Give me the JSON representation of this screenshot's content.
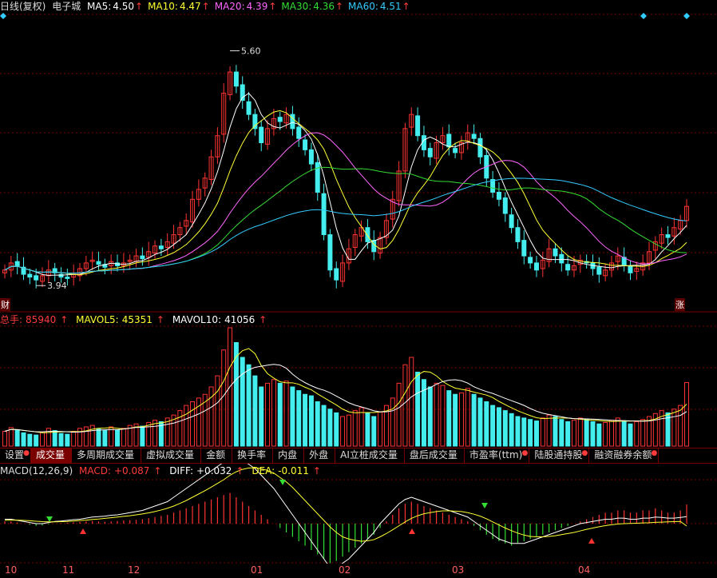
{
  "price_header": {
    "title": "日线(复权)",
    "stock": "电子城",
    "ma": [
      {
        "label": "MA5:",
        "value": "4.50",
        "color": "#ffffff"
      },
      {
        "label": "MA10:",
        "value": "4.47",
        "color": "#ffff33"
      },
      {
        "label": "MA20:",
        "value": "4.39",
        "color": "#ff66ff"
      },
      {
        "label": "MA30:",
        "value": "4.36",
        "color": "#33dd33"
      },
      {
        "label": "MA60:",
        "value": "4.51",
        "color": "#33ccff"
      }
    ],
    "arrow": "↑"
  },
  "price_annotations": {
    "high": "5.60",
    "low": "3.94"
  },
  "corner": {
    "left": "财",
    "right": "涨"
  },
  "volume_header": {
    "total_label": "总手:",
    "total_value": "85940",
    "mavol5_label": "MAVOL5:",
    "mavol5_value": "45351",
    "mavol10_label": "MAVOL10:",
    "mavol10_value": "41056",
    "arrow": "↑"
  },
  "tabs": [
    {
      "label": "设置",
      "dot": true
    },
    {
      "label": "成交量",
      "active": true
    },
    {
      "label": "多周期成交量"
    },
    {
      "label": "虚拟成交量"
    },
    {
      "label": "金额"
    },
    {
      "label": "换手率"
    },
    {
      "label": "内盘"
    },
    {
      "label": "外盘"
    },
    {
      "label": "AI立桩成交量"
    },
    {
      "label": "盘后成交量"
    },
    {
      "label": "市盈率(ttm)",
      "dot": true
    },
    {
      "label": "陆股通持股",
      "dot": true
    },
    {
      "label": "融资融券余额",
      "dot": true
    }
  ],
  "macd_header": {
    "title": "MACD(12,26,9)",
    "macd_label": "MACD:",
    "macd_value": "+0.087",
    "diff_label": "DIFF:",
    "diff_value": "+0.032",
    "dea_label": "DEA:",
    "dea_value": "-0.011",
    "arrow": "↑"
  },
  "x_axis": {
    "labels": [
      "10",
      "11",
      "12",
      "01",
      "02",
      "03",
      "04"
    ]
  },
  "colors": {
    "up": "#ff3333",
    "down": "#44eeee",
    "ma5": "#ffffff",
    "ma10": "#ffff33",
    "ma20": "#ff66ff",
    "ma30": "#33dd33",
    "ma60": "#33ccff",
    "grid": "#7a0000"
  },
  "chart_data": {
    "type": "candlestick",
    "price_range": [
      3.8,
      5.75
    ],
    "high": 5.6,
    "low": 3.94,
    "closes": [
      4.05,
      4.1,
      4.08,
      4.02,
      4.0,
      3.98,
      4.01,
      4.05,
      4.03,
      4.0,
      3.99,
      4.02,
      4.06,
      4.1,
      4.12,
      4.09,
      4.07,
      4.11,
      4.08,
      4.1,
      4.12,
      4.15,
      4.13,
      4.18,
      4.22,
      4.2,
      4.25,
      4.3,
      4.35,
      4.4,
      4.55,
      4.62,
      4.7,
      4.85,
      5.0,
      5.3,
      5.45,
      5.35,
      5.25,
      5.15,
      5.05,
      4.95,
      5.05,
      5.12,
      5.1,
      5.15,
      5.05,
      4.98,
      4.9,
      4.8,
      4.6,
      4.3,
      4.05,
      3.98,
      4.1,
      4.2,
      4.3,
      4.35,
      4.25,
      4.18,
      4.28,
      4.4,
      4.55,
      4.75,
      5.05,
      5.15,
      5.0,
      4.9,
      4.85,
      4.95,
      5.0,
      4.92,
      4.88,
      4.95,
      5.02,
      4.98,
      4.85,
      4.7,
      4.6,
      4.55,
      4.45,
      4.35,
      4.25,
      4.15,
      4.1,
      4.05,
      4.12,
      4.2,
      4.15,
      4.1,
      4.05,
      4.08,
      4.12,
      4.1,
      4.06,
      4.02,
      4.05,
      4.1,
      4.15,
      4.08,
      4.03,
      4.06,
      4.1,
      4.18,
      4.25,
      4.3,
      4.28,
      4.35,
      4.4,
      4.5
    ],
    "volumes": [
      20,
      25,
      22,
      18,
      16,
      15,
      19,
      24,
      21,
      17,
      16,
      20,
      24,
      26,
      28,
      23,
      21,
      26,
      22,
      24,
      28,
      30,
      27,
      32,
      35,
      33,
      38,
      42,
      48,
      55,
      60,
      65,
      70,
      80,
      95,
      130,
      160,
      140,
      120,
      110,
      95,
      80,
      85,
      90,
      85,
      88,
      80,
      75,
      70,
      68,
      60,
      55,
      50,
      45,
      40,
      42,
      48,
      52,
      45,
      40,
      46,
      55,
      65,
      85,
      110,
      120,
      100,
      90,
      80,
      85,
      82,
      75,
      70,
      72,
      78,
      70,
      65,
      60,
      55,
      52,
      48,
      44,
      40,
      38,
      36,
      34,
      38,
      42,
      40,
      36,
      33,
      35,
      38,
      36,
      33,
      30,
      32,
      35,
      38,
      34,
      30,
      33,
      36,
      40,
      44,
      48,
      45,
      50,
      55,
      86
    ],
    "macd_hist": [
      0.01,
      0.01,
      0.005,
      0,
      -0.005,
      -0.01,
      -0.008,
      -0.003,
      0,
      0.002,
      0.004,
      0.006,
      0.008,
      0.01,
      0.012,
      0.01,
      0.008,
      0.01,
      0.012,
      0.014,
      0.016,
      0.018,
      0.02,
      0.025,
      0.03,
      0.035,
      0.04,
      0.05,
      0.06,
      0.07,
      0.08,
      0.09,
      0.1,
      0.11,
      0.12,
      0.13,
      0.14,
      0.12,
      0.1,
      0.08,
      0.06,
      0.04,
      0.02,
      0,
      -0.02,
      -0.04,
      -0.06,
      -0.08,
      -0.1,
      -0.12,
      -0.14,
      -0.16,
      -0.18,
      -0.17,
      -0.15,
      -0.13,
      -0.11,
      -0.09,
      -0.07,
      -0.05,
      -0.02,
      0.01,
      0.04,
      0.07,
      0.09,
      0.1,
      0.09,
      0.08,
      0.07,
      0.06,
      0.05,
      0.04,
      0.03,
      0.02,
      0.01,
      -0.01,
      -0.03,
      -0.05,
      -0.07,
      -0.08,
      -0.09,
      -0.1,
      -0.09,
      -0.08,
      -0.07,
      -0.06,
      -0.05,
      -0.04,
      -0.03,
      -0.02,
      -0.01,
      0,
      0.01,
      0.02,
      0.03,
      0.04,
      0.05,
      0.05,
      0.06,
      0.06,
      0.05,
      0.05,
      0.06,
      0.06,
      0.07,
      0.06,
      0.05,
      0.05,
      0.06,
      0.087
    ],
    "macd_diff": [
      0.02,
      0.02,
      0.015,
      0.01,
      0.005,
      0,
      0,
      0.005,
      0.01,
      0.012,
      0.015,
      0.018,
      0.02,
      0.025,
      0.03,
      0.032,
      0.034,
      0.038,
      0.04,
      0.045,
      0.05,
      0.055,
      0.06,
      0.07,
      0.08,
      0.09,
      0.1,
      0.12,
      0.14,
      0.16,
      0.18,
      0.2,
      0.22,
      0.24,
      0.26,
      0.28,
      0.3,
      0.3,
      0.29,
      0.27,
      0.25,
      0.22,
      0.19,
      0.16,
      0.12,
      0.08,
      0.04,
      0,
      -0.04,
      -0.08,
      -0.12,
      -0.16,
      -0.2,
      -0.2,
      -0.18,
      -0.16,
      -0.13,
      -0.1,
      -0.07,
      -0.04,
      0,
      0.03,
      0.06,
      0.09,
      0.11,
      0.12,
      0.11,
      0.1,
      0.09,
      0.08,
      0.07,
      0.06,
      0.05,
      0.04,
      0.03,
      0.01,
      -0.01,
      -0.03,
      -0.05,
      -0.07,
      -0.08,
      -0.09,
      -0.09,
      -0.09,
      -0.08,
      -0.07,
      -0.06,
      -0.05,
      -0.04,
      -0.03,
      -0.02,
      -0.01,
      0,
      0.005,
      0.01,
      0.015,
      0.02,
      0.02,
      0.025,
      0.025,
      0.02,
      0.02,
      0.025,
      0.025,
      0.03,
      0.028,
      0.025,
      0.025,
      0.028,
      0.032
    ],
    "macd_dea": [
      0.015,
      0.016,
      0.016,
      0.015,
      0.013,
      0.011,
      0.009,
      0.008,
      0.008,
      0.009,
      0.01,
      0.012,
      0.014,
      0.016,
      0.019,
      0.021,
      0.024,
      0.027,
      0.03,
      0.033,
      0.036,
      0.04,
      0.044,
      0.049,
      0.055,
      0.062,
      0.07,
      0.08,
      0.092,
      0.105,
      0.12,
      0.135,
      0.15,
      0.166,
      0.183,
      0.2,
      0.22,
      0.236,
      0.247,
      0.253,
      0.254,
      0.25,
      0.242,
      0.23,
      0.21,
      0.19,
      0.165,
      0.135,
      0.105,
      0.075,
      0.045,
      0.015,
      -0.015,
      -0.04,
      -0.06,
      -0.07,
      -0.076,
      -0.08,
      -0.078,
      -0.073,
      -0.06,
      -0.045,
      -0.028,
      -0.01,
      0.008,
      0.024,
      0.036,
      0.045,
      0.05,
      0.055,
      0.058,
      0.058,
      0.057,
      0.055,
      0.05,
      0.043,
      0.034,
      0.022,
      0.008,
      -0.006,
      -0.02,
      -0.032,
      -0.043,
      -0.052,
      -0.058,
      -0.06,
      -0.06,
      -0.058,
      -0.055,
      -0.05,
      -0.045,
      -0.04,
      -0.033,
      -0.026,
      -0.02,
      -0.014,
      -0.009,
      -0.005,
      -0.002,
      0,
      0.001,
      0.002,
      0.003,
      0.004,
      0.006,
      0.007,
      0.008,
      0.009,
      0.01,
      -0.011
    ]
  }
}
